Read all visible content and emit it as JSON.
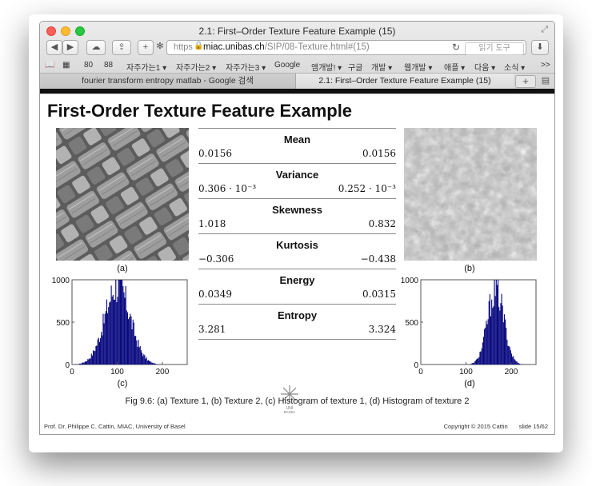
{
  "window": {
    "title": "2.1: First–Order Texture Feature Example (15)"
  },
  "url": {
    "protocol": "https",
    "host": "miac.unibas.ch",
    "path": "/SIP/08-Texture.html#(15)",
    "reader_label": "읽기 도구"
  },
  "bookmarks": [
    "80",
    "88",
    "자주가는1 ▾",
    "자주가는2 ▾",
    "자주가는3 ▾",
    "Google",
    "엠개발! ▾",
    "구글",
    "개발 ▾",
    "웹개발 ▾",
    "애플 ▾",
    "다움 ▾",
    "소식 ▾",
    ">>"
  ],
  "tabs": {
    "inactive": "fourier transform entropy matlab - Google 검색",
    "active": "2.1: First–Order Texture Feature Example (15)",
    "plus": "+"
  },
  "slide": {
    "title": "First-Order Texture Feature Example",
    "caption_a": "(a)",
    "caption_b": "(b)",
    "caption_c": "(c)",
    "caption_d": "(d)",
    "figure_caption": "Fig 9.6: (a) Texture 1, (b) Texture 2, (c) Histogram of texture 1, (d) Histogram of texture 2",
    "logo_text": "UNI BASEL",
    "footer_left": "Prof. Dr. Philippe C. Cattin, MIAC, University of Basel",
    "footer_copyright": "Copyright © 2015 Cattin",
    "footer_slide": "slide 15/62"
  },
  "stats": [
    {
      "name": "Mean",
      "v1": "0.0156",
      "v2": "0.0156"
    },
    {
      "name": "Variance",
      "v1": "0.306 · 10⁻³",
      "v2": "0.252 · 10⁻³"
    },
    {
      "name": "Skewness",
      "v1": "1.018",
      "v2": "0.832"
    },
    {
      "name": "Kurtosis",
      "v1": "−0.306",
      "v2": "−0.438"
    },
    {
      "name": "Energy",
      "v1": "0.0349",
      "v2": "0.0315"
    },
    {
      "name": "Entropy",
      "v1": "3.281",
      "v2": "3.324"
    }
  ],
  "histograms": {
    "c": {
      "yticks": [
        "0",
        "500",
        "1000"
      ],
      "xticks": [
        "0",
        "100",
        "200"
      ],
      "xlim": [
        0,
        255
      ],
      "ylim": [
        0,
        1000
      ],
      "peak_x": 100,
      "spread": 28,
      "peak": 1000,
      "color": "#0a0a80"
    },
    "d": {
      "yticks": [
        "0",
        "500",
        "1000"
      ],
      "xticks": [
        "0",
        "100",
        "200"
      ],
      "xlim": [
        0,
        255
      ],
      "ylim": [
        0,
        1000
      ],
      "peak_x": 165,
      "spread": 18,
      "peak": 960,
      "color": "#0a0a80"
    }
  }
}
